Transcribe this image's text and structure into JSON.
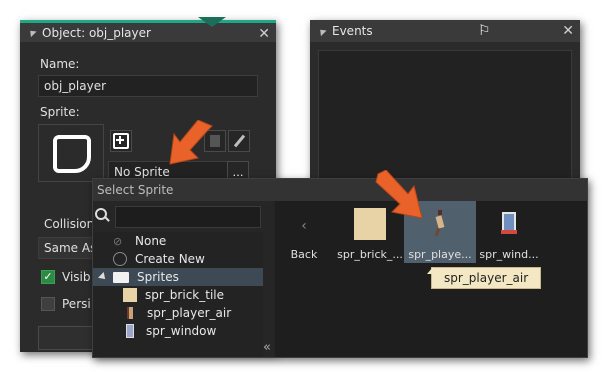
{
  "object_window": {
    "title": "Object: obj_player",
    "name_label": "Name:",
    "name_value": "obj_player",
    "sprite_label": "Sprite:",
    "sprite_value": "No Sprite",
    "collision_label": "Collision",
    "collision_value": "Same As",
    "visible_label": "Visib",
    "persistent_label": "Persi",
    "visible_checked": true,
    "persistent_checked": false
  },
  "events_window": {
    "title": "Events"
  },
  "select_sprite": {
    "title": "Select Sprite",
    "search_placeholder": "",
    "tree": [
      {
        "label": "None",
        "icon": "none-icon"
      },
      {
        "label": "Create New",
        "icon": "create-new-icon"
      },
      {
        "label": "Sprites",
        "icon": "folder-icon"
      },
      {
        "label": "spr_brick_tile",
        "icon": "brick-tile-thumb"
      },
      {
        "label": "spr_player_air",
        "icon": "player-air-thumb"
      },
      {
        "label": "spr_window",
        "icon": "window-thumb"
      }
    ],
    "collapse_glyph": "«",
    "assets": [
      {
        "label": "Back",
        "icon": "back-icon"
      },
      {
        "label": "spr_brick_...",
        "icon": "brick-tile-thumb"
      },
      {
        "label": "spr_playe...",
        "icon": "player-air-thumb"
      },
      {
        "label": "spr_wind...",
        "icon": "window-thumb"
      }
    ],
    "tooltip": "spr_player_air"
  },
  "colors": {
    "accent_green": "#1fa885",
    "panel_bg": "#2b2b2b",
    "titlebar_bg": "#3a3a3a",
    "brick_color": "#e8d3a7",
    "highlight_arrow": "#e8622a",
    "tooltip_bg": "#f4e7c3"
  }
}
